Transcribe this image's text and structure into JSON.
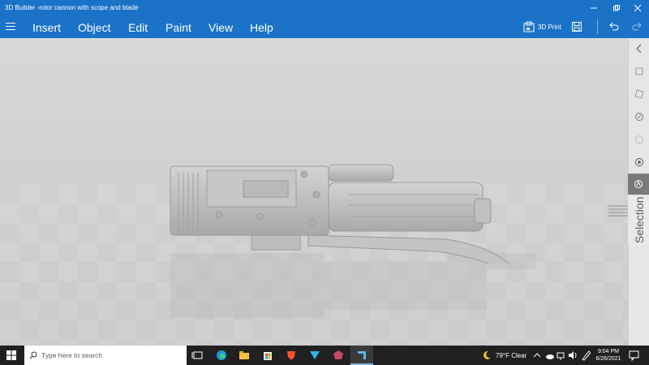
{
  "window": {
    "title": "3D Builder -rotor cannon with scope and blade"
  },
  "menu": {
    "items": [
      "Insert",
      "Object",
      "Edit",
      "Paint",
      "View",
      "Help"
    ]
  },
  "toolbar": {
    "print_label": "3D Print"
  },
  "right_panel": {
    "label": "Selection"
  },
  "taskbar": {
    "search_placeholder": "Type here to search",
    "weather": "79°F  Clear",
    "time": "9:04 PM",
    "date": "6/26/2021"
  },
  "colors": {
    "accent": "#1a73c7",
    "taskbar": "#202020",
    "viewport": "#d2d2d2",
    "model": "#bdbdbd"
  }
}
